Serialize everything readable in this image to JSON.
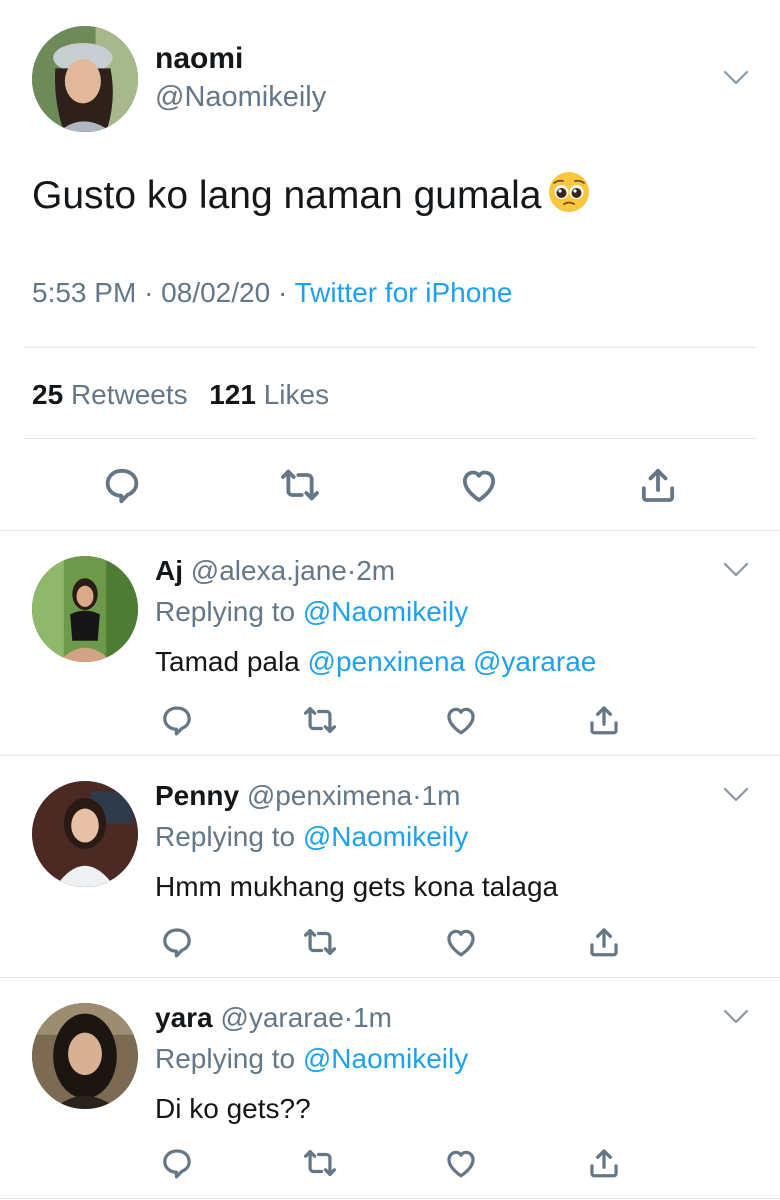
{
  "main_tweet": {
    "author_name": "naomi",
    "handle": "@Naomikeily",
    "text": "Gusto ko lang naman gumala",
    "emoji_icon": "pleading-face-emoji",
    "time": "5:53 PM",
    "sep1": "·",
    "date": "08/02/20",
    "sep2": "·",
    "source": "Twitter for iPhone",
    "retweet_count": "25",
    "retweets_label": "Retweets",
    "like_count": "121",
    "likes_label": "Likes"
  },
  "replies": [
    {
      "name": "Aj",
      "handle": "@alexa.jane",
      "dot": "·",
      "time": "2m",
      "replying_label": "Replying to",
      "replying_handle": "@Naomikeily",
      "text_plain": "Tamad pala ",
      "mention1": "@penxinena",
      "mention_space": " ",
      "mention2": "@yararae"
    },
    {
      "name": "Penny",
      "handle": "@penximena",
      "dot": "·",
      "time": "1m",
      "replying_label": "Replying to",
      "replying_handle": "@Naomikeily",
      "text": "Hmm mukhang gets kona talaga"
    },
    {
      "name": "yara",
      "handle": "@yararae",
      "dot": "·",
      "time": "1m",
      "replying_label": "Replying to",
      "replying_handle": "@Naomikeily",
      "text": "Di ko gets??"
    }
  ],
  "colors": {
    "text": "#14171a",
    "muted": "#657786",
    "link": "#1da1f2",
    "divider": "#e1e8ed"
  },
  "icons": [
    "reply-icon",
    "retweet-icon",
    "like-icon",
    "share-icon",
    "chevron-down-icon"
  ]
}
